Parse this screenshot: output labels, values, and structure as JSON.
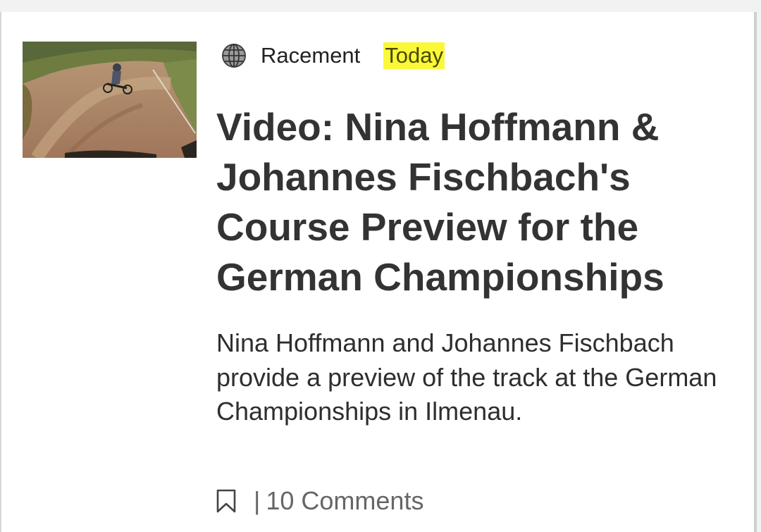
{
  "article": {
    "source_icon": "globe-icon",
    "source": "Racement",
    "date": "Today",
    "date_highlight_color": "#fbf83a",
    "title": "Video: Nina Hoffmann & Johannes Fischbach's Course Preview for the German Championships",
    "summary": "Nina Hoffmann and Johannes Fischbach provide a preview of the track at the German Championships in Ilmenau.",
    "thumbnail_icon": "mountain-bike-track-thumbnail",
    "bookmark_icon": "bookmark-icon",
    "separator": "|",
    "comments": "10 Comments"
  }
}
